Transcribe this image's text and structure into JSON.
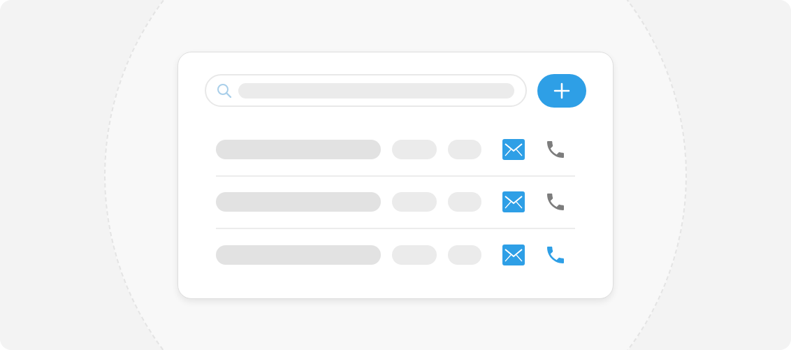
{
  "search": {
    "kind": "field"
  },
  "contacts": [
    {
      "call_active": false
    },
    {
      "call_active": false
    },
    {
      "call_active": true
    }
  ]
}
